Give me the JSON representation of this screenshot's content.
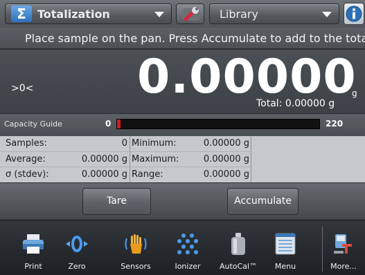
{
  "header": {
    "mode_label": "Totalization",
    "library_label": "Library",
    "icons": [
      "sigma-icon",
      "wrench-icon",
      "info-icon"
    ]
  },
  "message": "Place sample on the pan.  Press Accumulate to add to the total.",
  "display": {
    "zero_indicator": ">0<",
    "weight": "0.00000",
    "unit": "g",
    "total": "Total: 0.00000 g"
  },
  "capacity_guide": {
    "label": "Capacity Guide",
    "min": "0",
    "max": "220",
    "fill_fraction": 0.0
  },
  "stats": {
    "col1": [
      {
        "label": "Samples:",
        "value": "0"
      },
      {
        "label": "Average:",
        "value": "0.00000 g"
      },
      {
        "label": "σ (stdev):",
        "value": "0.00000 g"
      }
    ],
    "col2": [
      {
        "label": "Minimum:",
        "value": "0.00000 g"
      },
      {
        "label": "Maximum:",
        "value": "0.00000 g"
      },
      {
        "label": "Range:",
        "value": "0.00000 g"
      }
    ]
  },
  "actions": {
    "tare": "Tare",
    "accumulate": "Accumulate"
  },
  "nav": [
    {
      "label": "Print",
      "icon": "printer-icon"
    },
    {
      "label": "Zero",
      "icon": "zero-icon"
    },
    {
      "label": "Sensors",
      "icon": "sensor-hand-icon"
    },
    {
      "label": "Ionizer",
      "icon": "ionizer-icon"
    },
    {
      "label": "AutoCal™",
      "icon": "calibration-weight-icon"
    },
    {
      "label": "Menu",
      "icon": "menu-icon"
    },
    {
      "label": "More...",
      "icon": "more-icon"
    }
  ],
  "colors": {
    "accent_blue": "#2d6fb8",
    "capacity_red": "#d21a1a",
    "stats_bg": "#c6c9cc"
  }
}
